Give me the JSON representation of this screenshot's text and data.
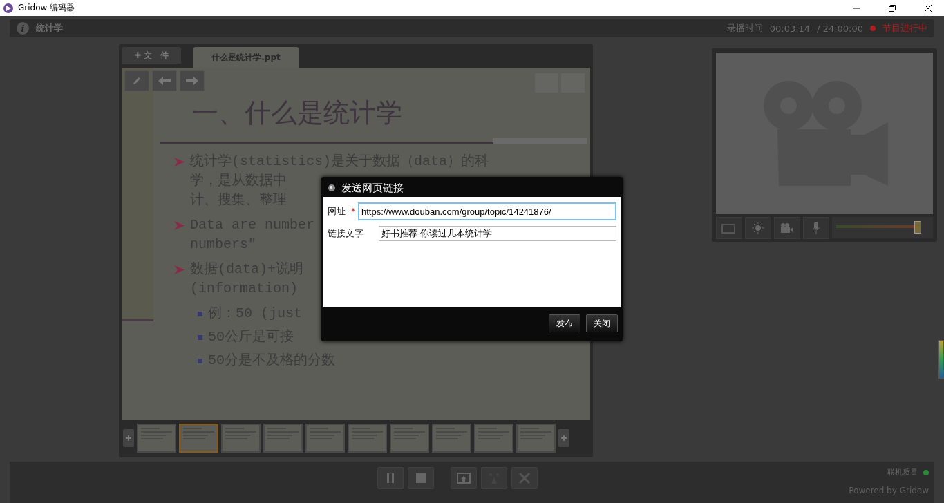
{
  "window": {
    "title": "Gridow 编码器"
  },
  "topbar": {
    "info_icon": "i",
    "program": "统计学",
    "record_label": "录播时间",
    "elapsed": "00:03:14",
    "total": "/ 24:00:00",
    "status": "节目进行中"
  },
  "editor": {
    "tabs": [
      {
        "label": "✚ 文　件",
        "selected": false
      },
      {
        "label": "什么是统计学.ppt",
        "selected": true
      }
    ],
    "slide": {
      "title": "一、什么是统计学",
      "bullets": [
        {
          "kind": "main",
          "lines": [
            "统计学(statistics)是关于数据（data）的科",
            "学，是从数据中",
            "计、搜集、整理"
          ]
        },
        {
          "kind": "main",
          "lines": [
            "Data are number",
            "numbers\""
          ]
        },
        {
          "kind": "main",
          "lines": [
            "数据(data)+说明",
            "(information)"
          ]
        },
        {
          "kind": "sub",
          "lines": [
            "例：50 (just"
          ]
        },
        {
          "kind": "sub",
          "lines": [
            "50公斤是可接"
          ]
        },
        {
          "kind": "sub",
          "lines": [
            "50分是不及格的分数"
          ]
        }
      ]
    },
    "thumbnails": [
      {
        "selected": false
      },
      {
        "selected": true
      },
      {
        "selected": false
      },
      {
        "selected": false
      },
      {
        "selected": false
      },
      {
        "selected": false
      },
      {
        "selected": false
      },
      {
        "selected": false
      },
      {
        "selected": false
      },
      {
        "selected": false
      }
    ]
  },
  "camera": {
    "volume": {
      "level": 0.84
    }
  },
  "bottom": {
    "quality_label": "联机质量",
    "powered": "Powered by Gridow"
  },
  "dialog": {
    "title": "发送网页链接",
    "fields": [
      {
        "label": "网址",
        "mark": "*",
        "value": "https://www.douban.com/group/topic/14241876/",
        "focused": true
      },
      {
        "label": "链接文字",
        "value": "好书推荐-你读过几本统计学",
        "focused": false
      }
    ],
    "buttons": [
      "发布",
      "关闭"
    ]
  }
}
